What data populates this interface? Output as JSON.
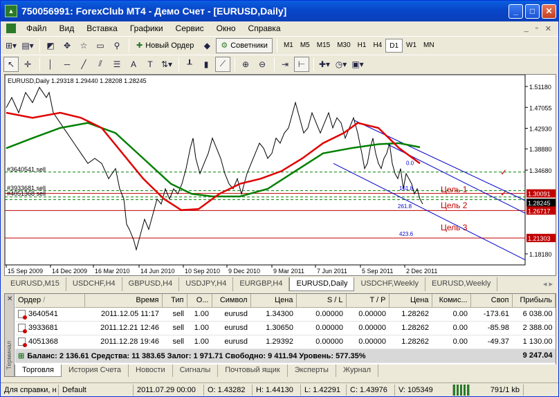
{
  "window": {
    "title": "750056991: ForexClub MT4 - Демо Счет - [EURUSD,Daily]"
  },
  "menu": {
    "items": [
      "Файл",
      "Вид",
      "Вставка",
      "Графики",
      "Сервис",
      "Окно",
      "Справка"
    ]
  },
  "toolbar": {
    "new_order": "Новый Ордер",
    "advisors": "Советники",
    "timeframes": [
      "M1",
      "M5",
      "M15",
      "M30",
      "H1",
      "H4",
      "D1",
      "W1",
      "MN"
    ],
    "active_tf": "D1"
  },
  "chart": {
    "header": "EURUSD,Daily  1.29318 1.29440 1.28208 1.28245",
    "price_labels": [
      "1.51180",
      "1.47055",
      "1.42930",
      "1.38880",
      "1.34680",
      "1.30091",
      "1.28245",
      "1.26717",
      "1.21303",
      "1.18180"
    ],
    "date_labels": [
      "15 Sep 2009",
      "14 Dec 2009",
      "16 Mar 2010",
      "14 Jun 2010",
      "10 Sep 2010",
      "9 Dec 2010",
      "9 Mar 2011",
      "7 Jun 2011",
      "5 Sep 2011",
      "2 Dec 2011"
    ],
    "order_labels": [
      "#3640541 sell",
      "#3933681 sell",
      "#4051368 sell"
    ],
    "targets": [
      "Цель 1",
      "Цель 2",
      "Цель 3"
    ],
    "fib_labels": [
      "0.0",
      "161.8",
      "261.8",
      "423.6"
    ],
    "colors": {
      "fast_ma": "#e00000",
      "slow_ma": "#008000",
      "price": "#000000",
      "channel": "#0000c8",
      "level": "#c00000",
      "sl": "#008000"
    }
  },
  "chart_tabs": [
    "EURUSD,M15",
    "USDCHF,H4",
    "GBPUSD,H4",
    "USDJPY,H4",
    "EURGBP,H4",
    "EURUSD,Daily",
    "USDCHF,Weekly",
    "EURUSD,Weekly"
  ],
  "chart_tab_active": "EURUSD,Daily",
  "terminal": {
    "columns": [
      "Ордер",
      "/",
      "Время",
      "Тип",
      "О...",
      "Символ",
      "Цена",
      "S / L",
      "T / P",
      "Цена",
      "Комис...",
      "Своп",
      "Прибыль"
    ],
    "rows": [
      [
        "3640541",
        "2011.12.05 11:17",
        "sell",
        "1.00",
        "eurusd",
        "1.34300",
        "0.00000",
        "0.00000",
        "1.28262",
        "0.00",
        "-173.61",
        "6 038.00"
      ],
      [
        "3933681",
        "2011.12.21 12:46",
        "sell",
        "1.00",
        "eurusd",
        "1.30650",
        "0.00000",
        "0.00000",
        "1.28262",
        "0.00",
        "-85.98",
        "2 388.00"
      ],
      [
        "4051368",
        "2011.12.28 19:46",
        "sell",
        "1.00",
        "eurusd",
        "1.29392",
        "0.00000",
        "0.00000",
        "1.28262",
        "0.00",
        "-49.37",
        "1 130.00"
      ]
    ],
    "summary": "Баланс: 2 136.61  Средства: 11 383.65  Залог: 1 971.71  Свободно: 9 411.94  Уровень: 577.35%",
    "summary_profit": "9 247.04",
    "side_label": "Терминал",
    "tabs": [
      "Торговля",
      "История Счета",
      "Новости",
      "Сигналы",
      "Почтовый ящик",
      "Эксперты",
      "Журнал"
    ]
  },
  "status": [
    "Для справки, н",
    "Default",
    "2011.07.29 00:00",
    "O: 1.43282",
    "H: 1.44130",
    "L: 1.42291",
    "C: 1.43976",
    "V: 105349",
    "791/1 kb"
  ]
}
